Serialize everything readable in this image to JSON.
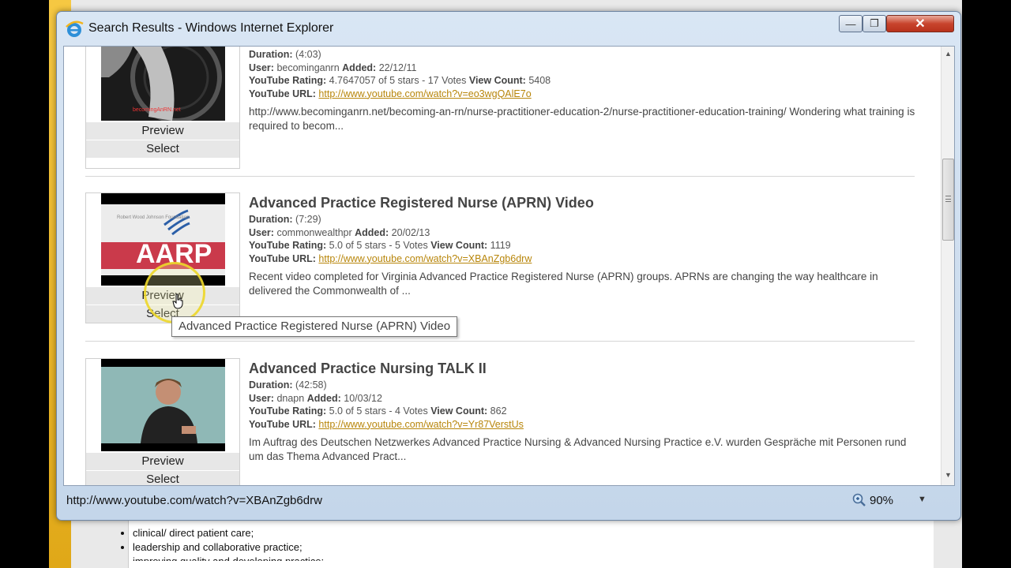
{
  "window": {
    "title": "Search Results - Windows Internet Explorer",
    "close_glyph": "✕",
    "min_glyph": "—",
    "max_glyph": "❐"
  },
  "results": [
    {
      "title": "",
      "duration_label": "Duration:",
      "duration": "(4:03)",
      "user_label": "User:",
      "user": "becominganrn",
      "added_label": "Added:",
      "added": "22/12/11",
      "rating_label": "YouTube Rating:",
      "rating": "4.7647057 of 5 stars - 17 Votes",
      "views_label": "View Count:",
      "views": "5408",
      "url_label": "YouTube URL:",
      "url": "http://www.youtube.com/watch?v=eo3wgQAlE7o",
      "description": "http://www.becominganrn.net/becoming-an-rn/nurse-practitioner-education-2/nurse-practitioner-education-training/ Wondering what training is required to becom...",
      "thumb_text": "becomingAnRN.net",
      "preview": "Preview",
      "select": "Select"
    },
    {
      "title": "Advanced Practice Registered Nurse (APRN) Video",
      "duration_label": "Duration:",
      "duration": "(7:29)",
      "user_label": "User:",
      "user": "commonwealthpr",
      "added_label": "Added:",
      "added": "20/02/13",
      "rating_label": "YouTube Rating:",
      "rating": "5.0 of 5 stars - 5 Votes",
      "views_label": "View Count:",
      "views": "1119",
      "url_label": "YouTube URL:",
      "url": "http://www.youtube.com/watch?v=XBAnZgb6drw",
      "description": "Recent video completed for Virginia Advanced Practice Registered Nurse (APRN) groups. APRNs are changing the way healthcare in delivered the Commonwealth of ...",
      "thumb_text": "AARP",
      "thumb_subtext": "Robert Wood Johnson Foundation",
      "preview": "Preview",
      "select": "Select"
    },
    {
      "title": "Advanced Practice Nursing TALK II",
      "duration_label": "Duration:",
      "duration": "(42:58)",
      "user_label": "User:",
      "user": "dnapn",
      "added_label": "Added:",
      "added": "10/03/12",
      "rating_label": "YouTube Rating:",
      "rating": "5.0 of 5 stars - 4 Votes",
      "views_label": "View Count:",
      "views": "862",
      "url_label": "YouTube URL:",
      "url": "http://www.youtube.com/watch?v=Yr87VerstUs",
      "description": "Im Auftrag des Deutschen Netzwerkes Advanced Practice Nursing & Advanced Nursing Practice e.V. wurden Gespräche mit Personen rund um das Thema Advanced Pract...",
      "preview": "Preview",
      "select": "Select"
    }
  ],
  "tooltip": "Advanced Practice Registered Nurse (APRN) Video",
  "statusbar": {
    "url": "http://www.youtube.com/watch?v=XBAnZgb6drw",
    "zoom": "90%",
    "dropdown_glyph": "▼"
  },
  "scrollbar": {
    "up_glyph": "▲",
    "down_glyph": "▼"
  },
  "background_list": [
    "clinical/ direct patient care;",
    "leadership and collaborative practice;",
    "improving quality and developing practice;"
  ],
  "colors": {
    "link": "#b8860b",
    "title": "#444444",
    "close_button": "#c8442d"
  }
}
